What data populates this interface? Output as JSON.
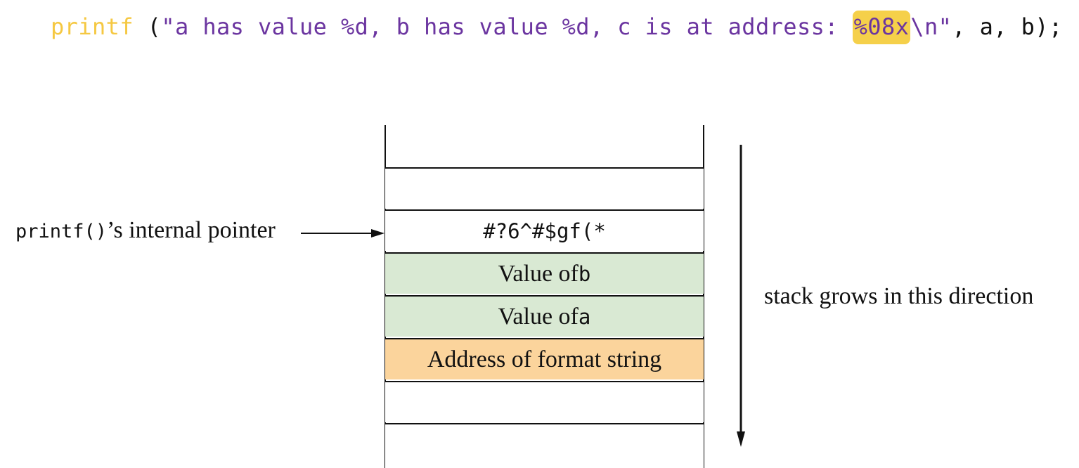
{
  "code": {
    "function_name": "printf",
    "open_paren": " (",
    "string_part1": "\"a has value %d, b has value %d, c is at address: ",
    "highlighted_specifier": "%08x",
    "string_part2": "\\n\"",
    "args": ", a, b);",
    "colors": {
      "function": "#f5c842",
      "string": "#6b35a0",
      "highlight": "#f5d04a",
      "default": "#111111"
    }
  },
  "stack": {
    "cells": [
      {
        "label": "",
        "fill": "#ffffff"
      },
      {
        "label": "",
        "fill": "#ffffff"
      },
      {
        "label": "#?6^#$gf(*",
        "fill": "#ffffff",
        "mono": true
      },
      {
        "label_prefix": "Value of ",
        "label_code": "b",
        "fill": "#d9e9d3"
      },
      {
        "label_prefix": "Value of ",
        "label_code": "a",
        "fill": "#d9e9d3"
      },
      {
        "label": "Address of format string",
        "fill": "#fbd49c"
      },
      {
        "label": "",
        "fill": "#ffffff"
      },
      {
        "label": "",
        "fill": "#ffffff"
      }
    ]
  },
  "pointer": {
    "label_code": "printf()",
    "label_text": "’s internal pointer"
  },
  "direction": {
    "label": "stack grows in this direction"
  }
}
